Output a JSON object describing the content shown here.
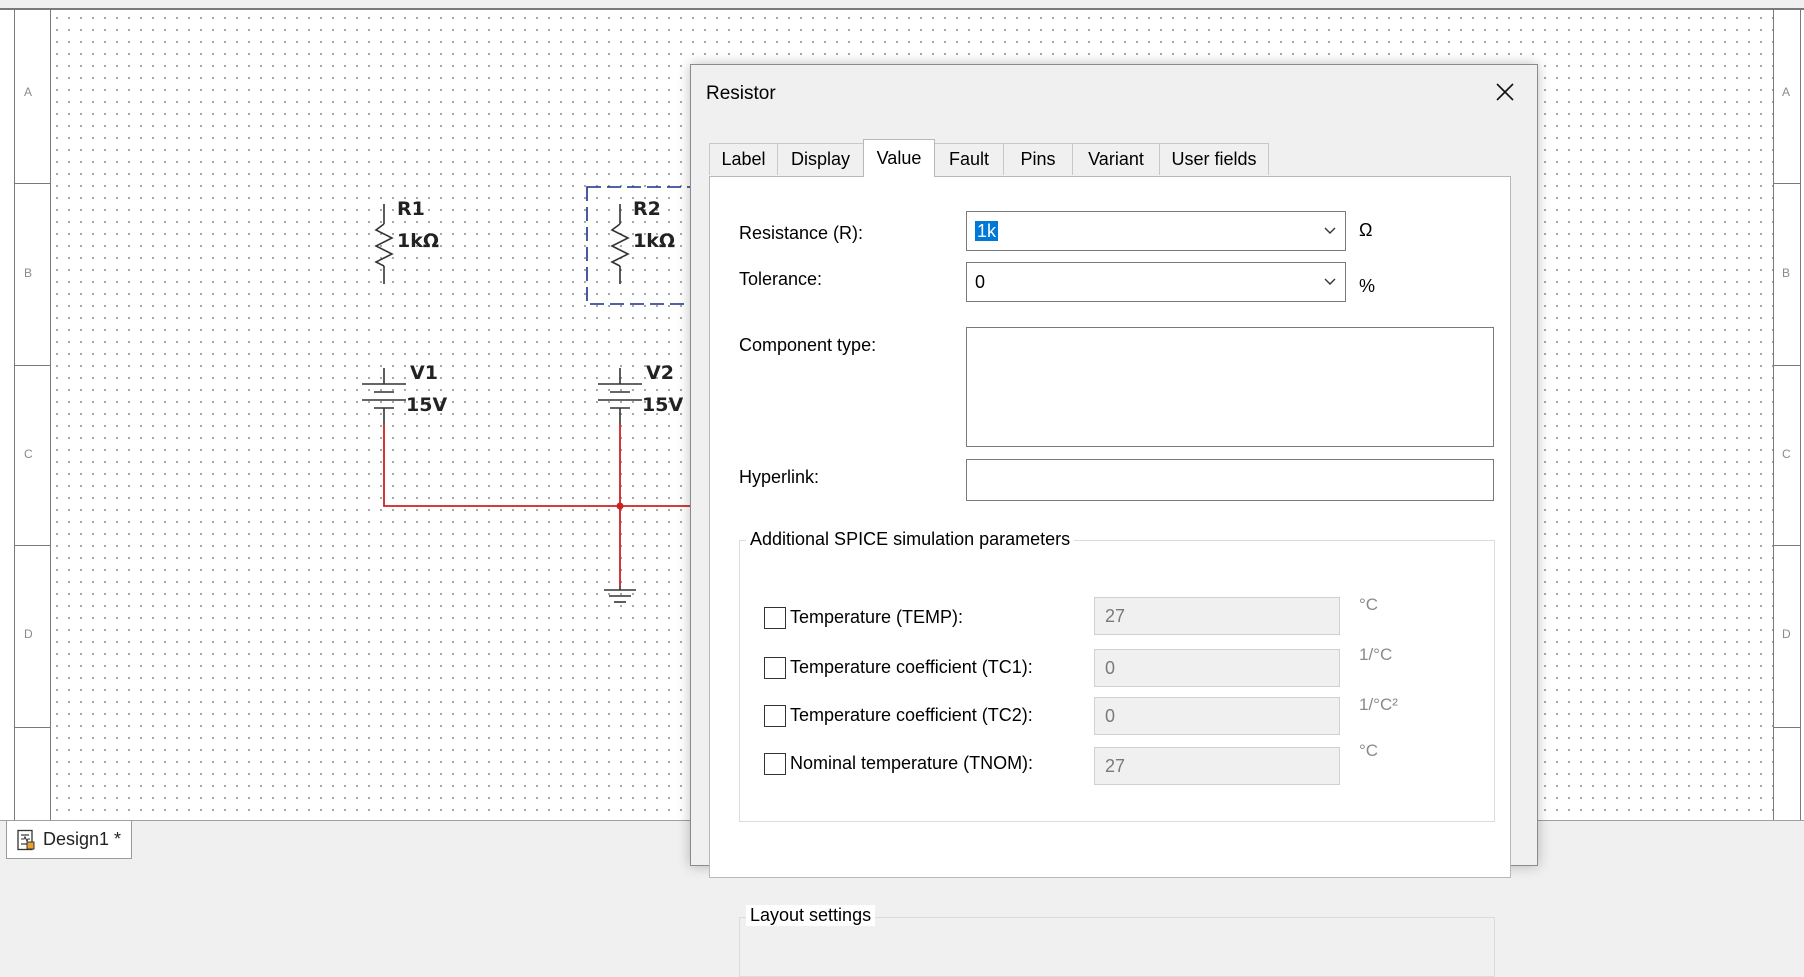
{
  "schematic": {
    "zone_letters": [
      "A",
      "B",
      "C",
      "D"
    ],
    "components": [
      {
        "ref": "R1",
        "value": "1kΩ"
      },
      {
        "ref": "R2",
        "value": "1kΩ"
      },
      {
        "ref": "V1",
        "value": "15V"
      },
      {
        "ref": "V2",
        "value": "15V"
      }
    ],
    "wire_color": "#cc2222",
    "selection_color": "#1a2f8c"
  },
  "tabbar": {
    "tabs": [
      {
        "label": "Design1 *",
        "icon": "schematic-document-icon"
      }
    ]
  },
  "dialog": {
    "title": "Resistor",
    "close_icon": "close-icon",
    "tabs": [
      {
        "label": "Label"
      },
      {
        "label": "Display"
      },
      {
        "label": "Value",
        "active": true
      },
      {
        "label": "Fault"
      },
      {
        "label": "Pins"
      },
      {
        "label": "Variant"
      },
      {
        "label": "User fields"
      }
    ],
    "value_tab": {
      "resistance": {
        "label": "Resistance (R):",
        "value": "1k",
        "unit": "Ω"
      },
      "tolerance": {
        "label": "Tolerance:",
        "value": "0",
        "unit": "%"
      },
      "component_type": {
        "label": "Component type:",
        "value": ""
      },
      "hyperlink": {
        "label": "Hyperlink:",
        "value": ""
      },
      "spice_group": {
        "title": "Additional SPICE simulation parameters",
        "params": [
          {
            "label": "Temperature (TEMP):",
            "value": "27",
            "unit": "°C",
            "checked": false
          },
          {
            "label": "Temperature coefficient (TC1):",
            "value": "0",
            "unit": "1/°C",
            "checked": false
          },
          {
            "label": "Temperature coefficient (TC2):",
            "value": "0",
            "unit": "1/°C²",
            "checked": false
          },
          {
            "label": "Nominal temperature (TNOM):",
            "value": "27",
            "unit": "°C",
            "checked": false
          }
        ]
      },
      "layout_group": {
        "title": "Layout settings"
      }
    }
  }
}
